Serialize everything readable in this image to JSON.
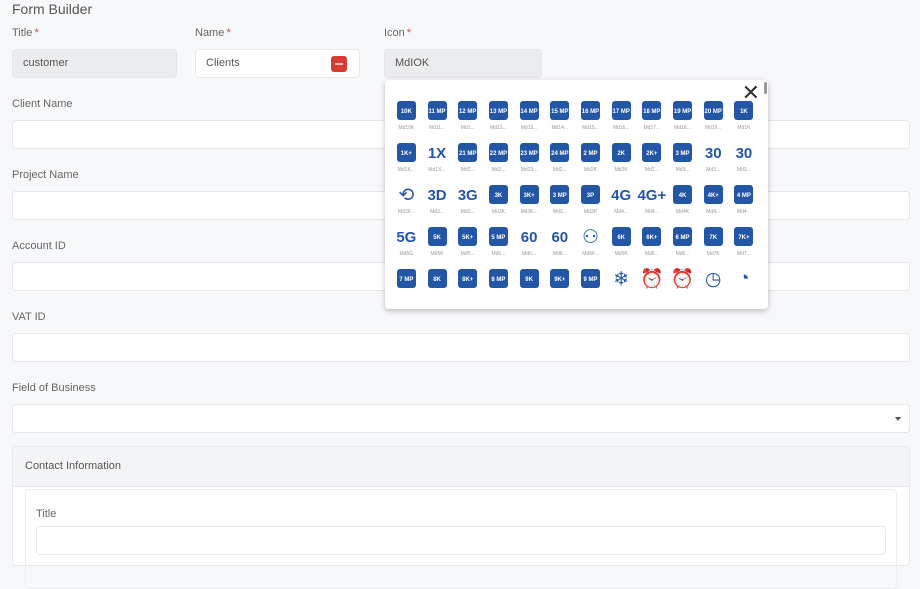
{
  "page_title": "Form Builder",
  "fields": {
    "title": {
      "label": "Title",
      "value": "customer"
    },
    "name": {
      "label": "Name",
      "value": "Clients"
    },
    "icon": {
      "label": "Icon",
      "value": "MdIOK"
    },
    "client_name": {
      "label": "Client Name",
      "value": ""
    },
    "project_name": {
      "label": "Project Name",
      "value": ""
    },
    "account_id": {
      "label": "Account ID",
      "value": ""
    },
    "vat_id": {
      "label": "VAT ID",
      "value": ""
    },
    "field_of_business": {
      "label": "Field of Business",
      "value": ""
    }
  },
  "required_mark": "*",
  "contact_section": {
    "header": "Contact Information",
    "title_label": "Title"
  },
  "icon_picker": {
    "close": "✕",
    "accent": "#2456a6",
    "icons": [
      {
        "g": "10K",
        "k": "box",
        "c": "Md10K"
      },
      {
        "g": "11 MP",
        "k": "box",
        "c": "Md11..."
      },
      {
        "g": "12 MP",
        "k": "box",
        "c": "Md1..."
      },
      {
        "g": "13 MP",
        "k": "box",
        "c": "Md13..."
      },
      {
        "g": "14 MP",
        "k": "box",
        "c": "Md13..."
      },
      {
        "g": "15 MP",
        "k": "box",
        "c": "Md14..."
      },
      {
        "g": "16 MP",
        "k": "box",
        "c": "Md15..."
      },
      {
        "g": "17 MP",
        "k": "box",
        "c": "Md16..."
      },
      {
        "g": "18 MP",
        "k": "box",
        "c": "Md17..."
      },
      {
        "g": "19 MP",
        "k": "box",
        "c": "Md18..."
      },
      {
        "g": "20 MP",
        "k": "box",
        "c": "Md19..."
      },
      {
        "g": "1K",
        "k": "box",
        "c": "Md1K"
      },
      {
        "g": "1K+",
        "k": "box",
        "c": "Md1K..."
      },
      {
        "g": "1X",
        "k": "txt",
        "c": "Md1X..."
      },
      {
        "g": "21 MP",
        "k": "box",
        "c": "Md2..."
      },
      {
        "g": "22 MP",
        "k": "box",
        "c": "Md2..."
      },
      {
        "g": "23 MP",
        "k": "box",
        "c": "Md23..."
      },
      {
        "g": "24 MP",
        "k": "box",
        "c": "Md2..."
      },
      {
        "g": "2 MP",
        "k": "box",
        "c": "Md2K"
      },
      {
        "g": "2K",
        "k": "box",
        "c": "Md2K"
      },
      {
        "g": "2K+",
        "k": "box",
        "c": "Md2..."
      },
      {
        "g": "3 MP",
        "k": "box",
        "c": "Md3..."
      },
      {
        "g": "30",
        "k": "txt",
        "c": "Md3..."
      },
      {
        "g": "30",
        "k": "txt",
        "c": "Md3..."
      },
      {
        "g": "⟲",
        "k": "sym",
        "c": "Md36..."
      },
      {
        "g": "3D",
        "k": "txt",
        "c": "Md3..."
      },
      {
        "g": "3G",
        "k": "txt",
        "c": "Md3..."
      },
      {
        "g": "3K",
        "k": "box",
        "c": "Md3K"
      },
      {
        "g": "3K+",
        "k": "box",
        "c": "Md3K..."
      },
      {
        "g": "3 MP",
        "k": "box",
        "c": "Md3..."
      },
      {
        "g": "3P",
        "k": "box",
        "c": "Md3P"
      },
      {
        "g": "4G",
        "k": "txt",
        "c": "Md4..."
      },
      {
        "g": "4G+",
        "k": "txt",
        "c": "Md4..."
      },
      {
        "g": "4K",
        "k": "box",
        "c": "Md4K"
      },
      {
        "g": "4K+",
        "k": "box",
        "c": "Md4..."
      },
      {
        "g": "4 MP",
        "k": "box",
        "c": "Md4..."
      },
      {
        "g": "5G",
        "k": "txt",
        "c": "Md5G"
      },
      {
        "g": "5K",
        "k": "box",
        "c": "Md5K"
      },
      {
        "g": "5K+",
        "k": "box",
        "c": "Md5..."
      },
      {
        "g": "5 MP",
        "k": "box",
        "c": "Md5..."
      },
      {
        "g": "60",
        "k": "txt",
        "c": "Md6..."
      },
      {
        "g": "60",
        "k": "txt",
        "c": "Md6..."
      },
      {
        "g": "⚇",
        "k": "sym",
        "c": "Md6F..."
      },
      {
        "g": "6K",
        "k": "box",
        "c": "Md6K"
      },
      {
        "g": "6K+",
        "k": "box",
        "c": "Md6..."
      },
      {
        "g": "6 MP",
        "k": "box",
        "c": "Md6..."
      },
      {
        "g": "7K",
        "k": "box",
        "c": "Md7K"
      },
      {
        "g": "7K+",
        "k": "box",
        "c": "Md7..."
      },
      {
        "g": "7 MP",
        "k": "box",
        "c": ""
      },
      {
        "g": "8K",
        "k": "box",
        "c": ""
      },
      {
        "g": "8K+",
        "k": "box",
        "c": ""
      },
      {
        "g": "8 MP",
        "k": "box",
        "c": ""
      },
      {
        "g": "9K",
        "k": "box",
        "c": ""
      },
      {
        "g": "9K+",
        "k": "box",
        "c": ""
      },
      {
        "g": "9 MP",
        "k": "box",
        "c": ""
      },
      {
        "g": "❄",
        "k": "sym",
        "c": ""
      },
      {
        "g": "⏰",
        "k": "sym",
        "c": ""
      },
      {
        "g": "⏰",
        "k": "sym",
        "c": ""
      },
      {
        "g": "◷",
        "k": "sym",
        "c": ""
      },
      {
        "g": "◔",
        "k": "sym",
        "c": ""
      }
    ]
  }
}
